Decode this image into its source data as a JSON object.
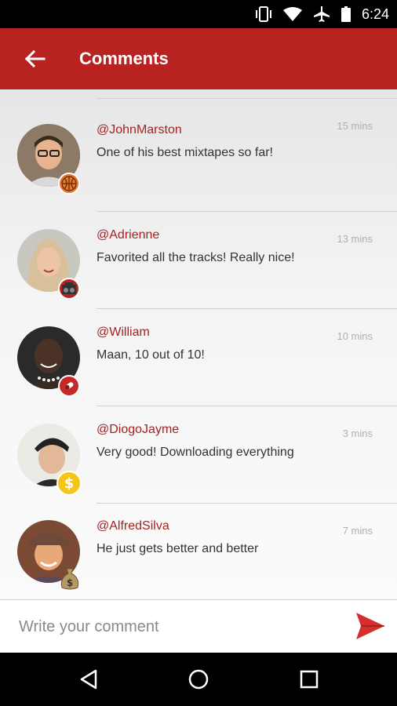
{
  "status_bar": {
    "time": "6:24"
  },
  "app_bar": {
    "title": "Comments"
  },
  "comments": [
    {
      "username": "@JohnMarston",
      "time": "15 mins",
      "text": "One of his best mixtapes so far!",
      "badge": "basketball-icon"
    },
    {
      "username": "@Adrienne",
      "time": "13 mins",
      "text": "Favorited all the tracks! Really nice!",
      "badge": "boombox-icon"
    },
    {
      "username": "@William",
      "time": "10 mins",
      "text": "Maan, 10 out of 10!",
      "badge": "red-pill-icon"
    },
    {
      "username": "@DiogoJayme",
      "time": "3 mins",
      "text": "Very good! Downloading everything",
      "badge": "dollar-coin-icon"
    },
    {
      "username": "@AlfredSilva",
      "time": "7 mins",
      "text": "He just gets better and better",
      "badge": "money-bag-icon"
    }
  ],
  "composer": {
    "placeholder": "Write your comment"
  },
  "colors": {
    "primary": "#b82321",
    "username": "#a91f1f",
    "timestamp": "#b0b0b0"
  }
}
